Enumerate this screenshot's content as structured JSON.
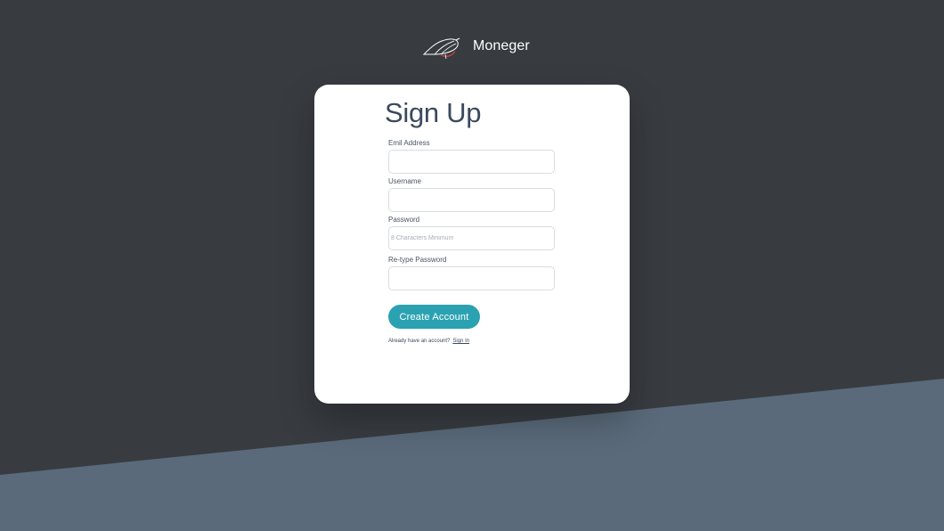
{
  "brand": {
    "name": "Moneger",
    "logo_icon": "bird-logo-icon"
  },
  "colors": {
    "background_dark": "#383c41",
    "background_slant": "#5a6a7a",
    "accent": "#2ba2b1",
    "logo_accent": "#d9443a"
  },
  "signup": {
    "title": "Sign Up",
    "fields": {
      "email": {
        "label": "Emil Address",
        "value": "",
        "placeholder": ""
      },
      "username": {
        "label": "Username",
        "value": "",
        "placeholder": ""
      },
      "password": {
        "label": "Password",
        "value": "",
        "placeholder": "8 Characters Minimum"
      },
      "retype_password": {
        "label": "Re-type Password",
        "value": "",
        "placeholder": ""
      }
    },
    "submit_label": "Create Account",
    "footer_text": "Already have an account?",
    "footer_link": "Sign In"
  }
}
